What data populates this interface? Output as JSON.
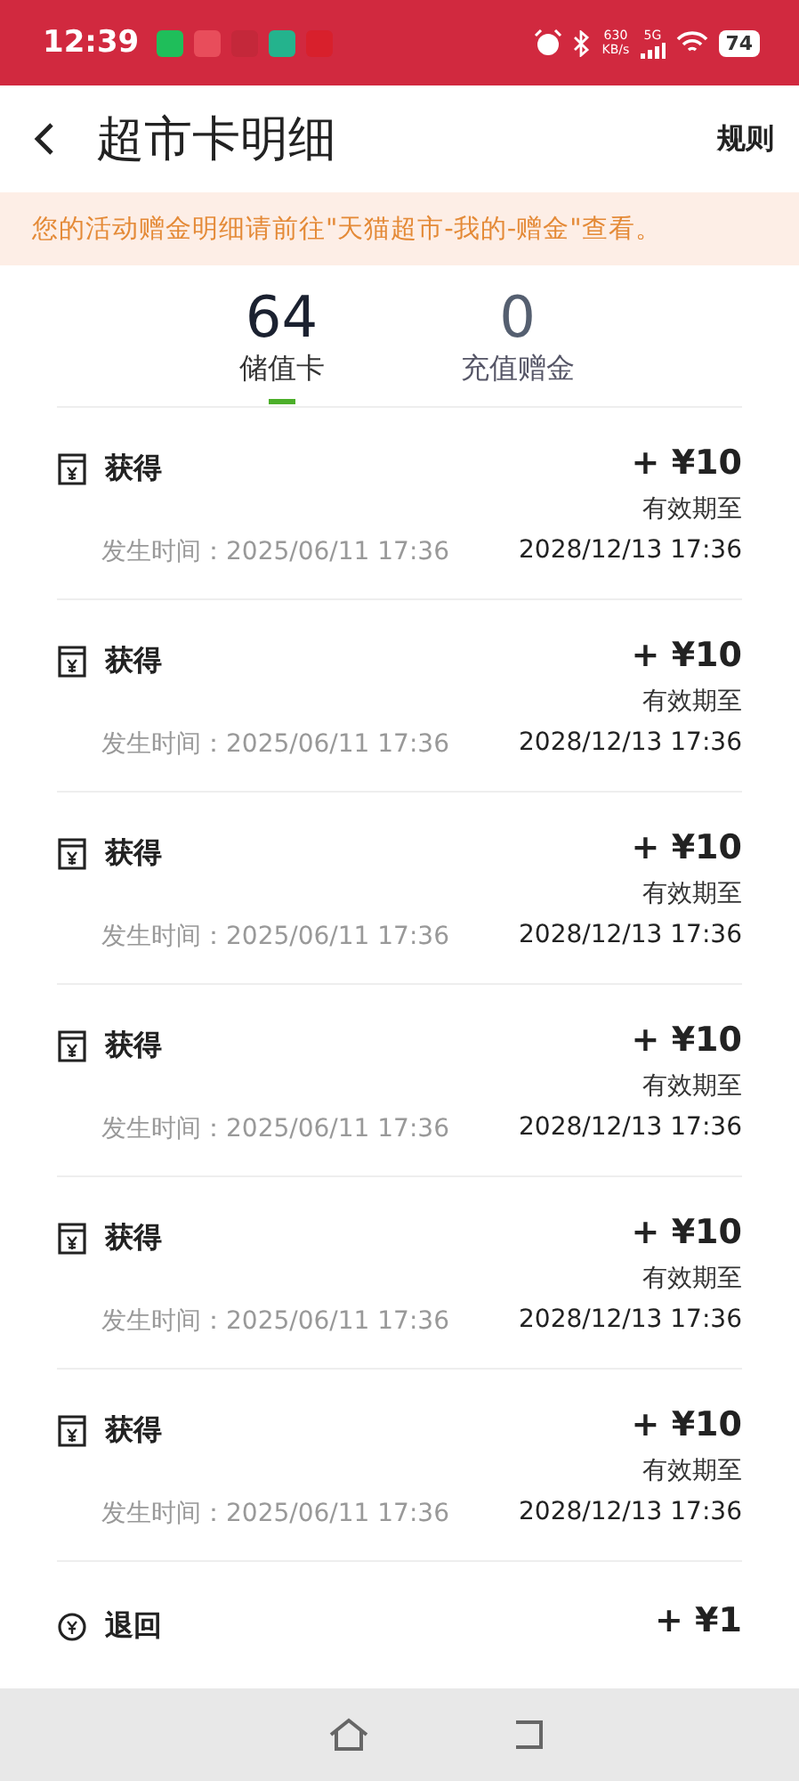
{
  "status_bar": {
    "time": "12:39",
    "speed_value": "630",
    "speed_unit": "KB/s",
    "network": "5G",
    "battery": "74"
  },
  "header": {
    "title": "超市卡明细",
    "action": "规则"
  },
  "notice": "您的活动赠金明细请前往\"天猫超市-我的-赠金\"查看。",
  "tabs": [
    {
      "count": "64",
      "label": "储值卡",
      "selected": true
    },
    {
      "count": "0",
      "label": "充值赠金",
      "selected": false
    }
  ],
  "records": [
    {
      "kind": "card",
      "title": "获得",
      "amount": "+ ¥10",
      "expiry_label": "有效期至",
      "time": "发生时间：2025/06/11 17:36",
      "expiry": "2028/12/13 17:36"
    },
    {
      "kind": "card",
      "title": "获得",
      "amount": "+ ¥10",
      "expiry_label": "有效期至",
      "time": "发生时间：2025/06/11 17:36",
      "expiry": "2028/12/13 17:36"
    },
    {
      "kind": "card",
      "title": "获得",
      "amount": "+ ¥10",
      "expiry_label": "有效期至",
      "time": "发生时间：2025/06/11 17:36",
      "expiry": "2028/12/13 17:36"
    },
    {
      "kind": "card",
      "title": "获得",
      "amount": "+ ¥10",
      "expiry_label": "有效期至",
      "time": "发生时间：2025/06/11 17:36",
      "expiry": "2028/12/13 17:36"
    },
    {
      "kind": "card",
      "title": "获得",
      "amount": "+ ¥10",
      "expiry_label": "有效期至",
      "time": "发生时间：2025/06/11 17:36",
      "expiry": "2028/12/13 17:36"
    },
    {
      "kind": "card",
      "title": "获得",
      "amount": "+ ¥10",
      "expiry_label": "有效期至",
      "time": "发生时间：2025/06/11 17:36",
      "expiry": "2028/12/13 17:36"
    },
    {
      "kind": "refund",
      "title": "退回",
      "amount": "+ ¥1"
    }
  ]
}
